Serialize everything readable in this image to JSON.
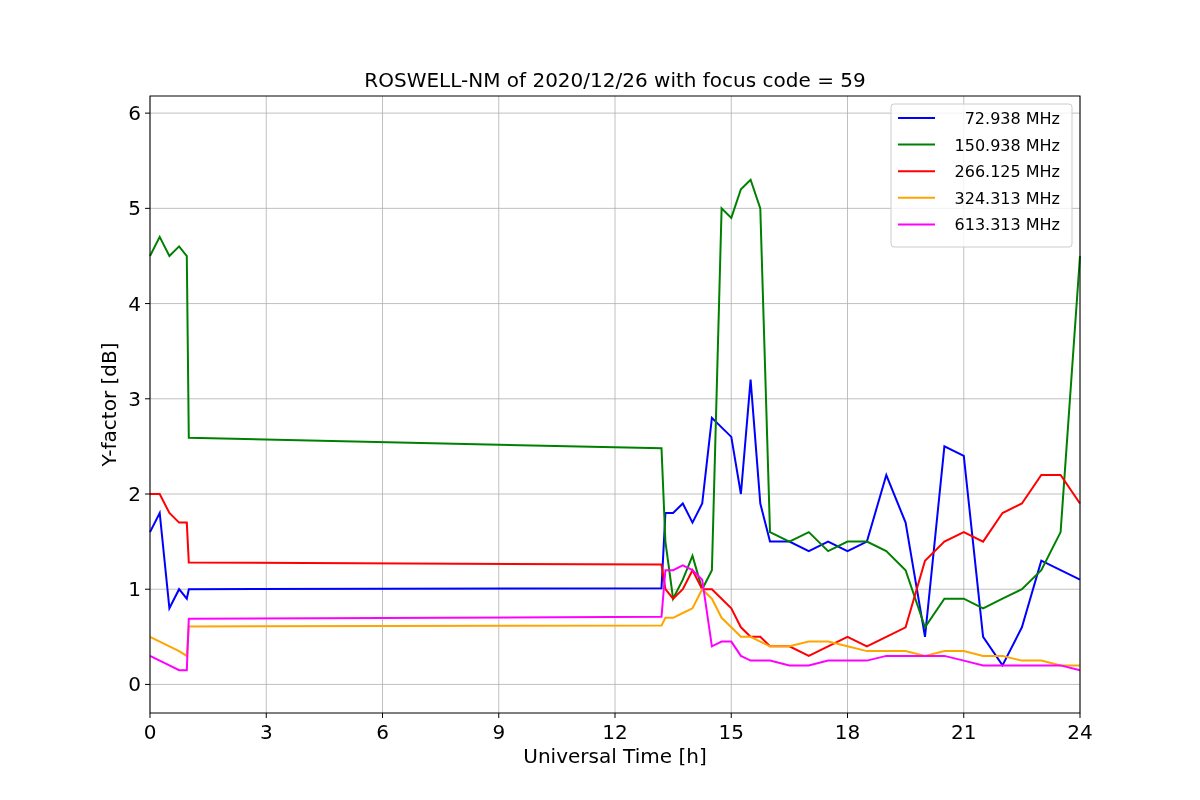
{
  "chart_data": {
    "type": "line",
    "title": "ROSWELL-NM of 2020/12/26 with focus code = 59",
    "xlabel": "Universal Time [h]",
    "ylabel": "Y-factor [dB]",
    "x": [
      0,
      0.25,
      0.5,
      0.75,
      0.95,
      1.0,
      13.2,
      13.3,
      13.5,
      13.75,
      14,
      14.25,
      14.5,
      14.75,
      15,
      15.25,
      15.5,
      15.75,
      16,
      16.5,
      17,
      17.5,
      18,
      18.5,
      19,
      19.5,
      20,
      20.5,
      21,
      21.5,
      22,
      22.5,
      23,
      23.5,
      24
    ],
    "series": [
      {
        "name": "72.938 MHz",
        "color": "#0000ff",
        "values": [
          1.6,
          1.8,
          0.8,
          1.0,
          0.9,
          1.0,
          1.01,
          1.8,
          1.8,
          1.9,
          1.7,
          1.9,
          2.8,
          2.7,
          2.6,
          2.0,
          3.2,
          1.9,
          1.5,
          1.5,
          1.4,
          1.5,
          1.4,
          1.5,
          2.2,
          1.7,
          0.5,
          2.5,
          2.4,
          0.5,
          0.2,
          0.6,
          1.3,
          1.2,
          1.1
        ]
      },
      {
        "name": "150.938 MHz",
        "color": "#008000",
        "values": [
          4.5,
          4.7,
          4.5,
          4.6,
          4.5,
          2.59,
          2.48,
          1.5,
          0.9,
          1.1,
          1.35,
          1.0,
          1.2,
          5.0,
          4.9,
          5.2,
          5.3,
          5.0,
          1.6,
          1.5,
          1.6,
          1.4,
          1.5,
          1.5,
          1.4,
          1.2,
          0.6,
          0.9,
          0.9,
          0.8,
          0.9,
          1.0,
          1.2,
          1.6,
          4.5
        ]
      },
      {
        "name": "266.125 MHz",
        "color": "#ff0000",
        "values": [
          2.0,
          2.0,
          1.8,
          1.7,
          1.7,
          1.28,
          1.26,
          1.0,
          0.9,
          1.0,
          1.2,
          1.0,
          1.0,
          0.9,
          0.8,
          0.6,
          0.5,
          0.5,
          0.4,
          0.4,
          0.3,
          0.4,
          0.5,
          0.4,
          0.5,
          0.6,
          1.3,
          1.5,
          1.6,
          1.5,
          1.8,
          1.9,
          2.2,
          2.2,
          1.9
        ]
      },
      {
        "name": "324.313 MHz",
        "color": "#ffa500",
        "values": [
          0.5,
          0.45,
          0.4,
          0.35,
          0.3,
          0.61,
          0.62,
          0.7,
          0.7,
          0.75,
          0.8,
          1.0,
          0.9,
          0.7,
          0.6,
          0.5,
          0.5,
          0.45,
          0.4,
          0.4,
          0.45,
          0.45,
          0.4,
          0.35,
          0.35,
          0.35,
          0.3,
          0.35,
          0.35,
          0.3,
          0.3,
          0.25,
          0.25,
          0.2,
          0.2
        ]
      },
      {
        "name": "613.313 MHz",
        "color": "#ff00ff",
        "values": [
          0.3,
          0.25,
          0.2,
          0.15,
          0.15,
          0.69,
          0.71,
          1.2,
          1.2,
          1.25,
          1.2,
          1.1,
          0.4,
          0.45,
          0.45,
          0.3,
          0.25,
          0.25,
          0.25,
          0.2,
          0.2,
          0.25,
          0.25,
          0.25,
          0.3,
          0.3,
          0.3,
          0.3,
          0.25,
          0.2,
          0.2,
          0.2,
          0.2,
          0.2,
          0.15
        ]
      }
    ],
    "grid": true,
    "legend": true,
    "xlim": [
      0,
      24
    ],
    "ylim": [
      -0.3,
      6.18
    ],
    "xticks": [
      0,
      3,
      6,
      9,
      12,
      15,
      18,
      21,
      24
    ],
    "yticks": [
      0,
      1,
      2,
      3,
      4,
      5,
      6
    ]
  }
}
